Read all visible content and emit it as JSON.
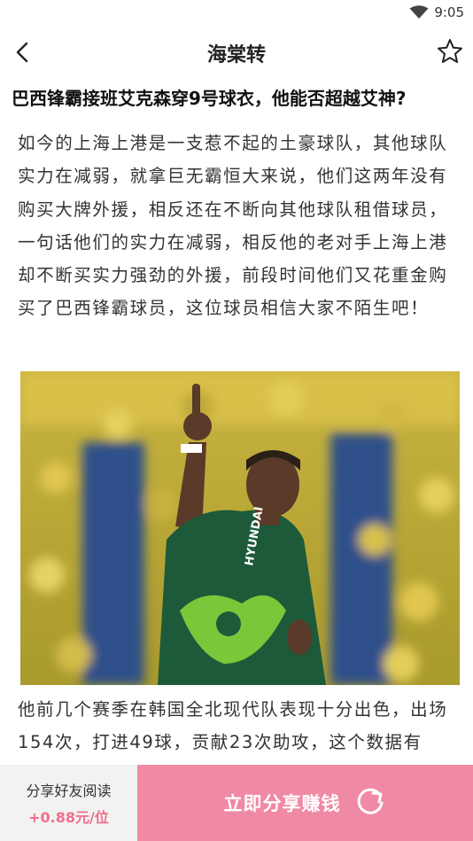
{
  "status_bar": {
    "time": "9:05",
    "wifi_icon": "wifi-icon"
  },
  "nav": {
    "title": "海棠转",
    "back_icon": "back-arrow-icon",
    "favorite_icon": "star-icon"
  },
  "article": {
    "title": "巴西锋霸接班艾克森穿9号球衣，他能否超越艾神?",
    "paragraphs": [
      "如今的上海上港是一支惹不起的土豪球队，其他球队实力在减弱，就拿巨无霸恒大来说，他们这两年没有购买大牌外援，相反还在不断向其他球队租借球员，一句话他们的实力在减弱，相反他的老对手上海上港却不断买实力强劲的外援，前段时间他们又花重金购买了巴西锋霸球员，这位球员相信大家不陌生吧！",
      "他前几个赛季在韩国全北现代队表现十分出色，出场154次，打进49球，贡献23次助攻，这个数据有"
    ],
    "image": {
      "jersey_text": "HYUNDAI",
      "accent_color": "#1d5a3a"
    }
  },
  "bottom_bar": {
    "share_info_label": "分享好友阅读",
    "share_reward": "+0.88元/位",
    "share_button_label": "立即分享赚钱",
    "share_icon": "refresh-share-icon",
    "colors": {
      "button_bg": "#f08aa4",
      "reward_text": "#ee6f8b",
      "info_bg": "#f2f2f2"
    }
  }
}
